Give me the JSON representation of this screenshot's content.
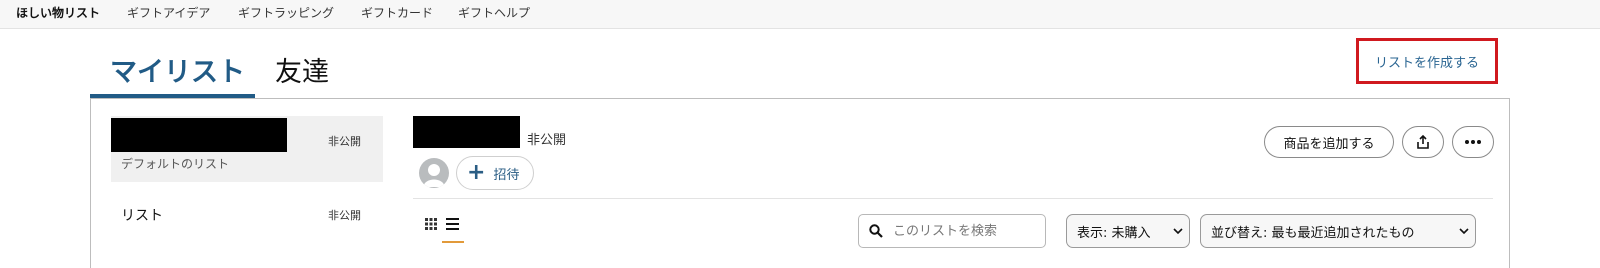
{
  "topnav": {
    "items": [
      {
        "label": "ほしい物リスト",
        "active": true
      },
      {
        "label": "ギフトアイデア"
      },
      {
        "label": "ギフトラッピング"
      },
      {
        "label": "ギフトカード"
      },
      {
        "label": "ギフトヘルプ"
      }
    ]
  },
  "tabs": [
    {
      "label": "マイリスト",
      "active": true
    },
    {
      "label": "友達"
    }
  ],
  "create_list_link": "リストを作成する",
  "lists": [
    {
      "privacy": "非公開",
      "subtitle": "デフォルトのリスト",
      "selected": true
    },
    {
      "name": "リスト",
      "privacy": "非公開"
    }
  ],
  "detail": {
    "privacy": "非公開",
    "invite_label": "招待",
    "add_item_label": "商品を追加する",
    "share_icon": "share-icon",
    "more_icon": "more-icon"
  },
  "toolbar": {
    "search_placeholder": "このリストを検索",
    "filter_label": "表示: 未購入",
    "sort_label": "並び替え: 最も最近追加されたもの"
  },
  "colors": {
    "accent": "#215b86",
    "highlight_box": "#d0191f",
    "link": "#2a6592",
    "view_underline": "#e29a3a"
  }
}
